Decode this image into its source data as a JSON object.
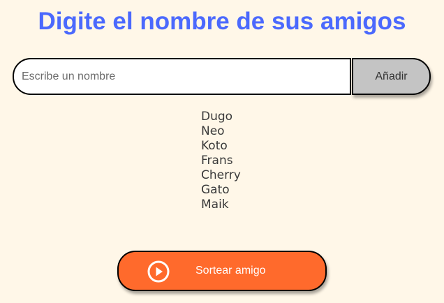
{
  "header": {
    "title": "Digite el nombre de sus amigos"
  },
  "input": {
    "placeholder": "Escribe un nombre",
    "value": ""
  },
  "add_button": {
    "label": "Añadir"
  },
  "friends": [
    "Dugo",
    "Neo",
    "Koto",
    "Frans",
    "Cherry",
    "Gato",
    "Maik"
  ],
  "draw_button": {
    "label": "Sortear amigo",
    "icon": "play-circle-icon"
  },
  "colors": {
    "background": "#FFF7E8",
    "title": "#4B69FD",
    "draw_button": "#FF6A2C",
    "add_button": "#C4C4C4"
  }
}
